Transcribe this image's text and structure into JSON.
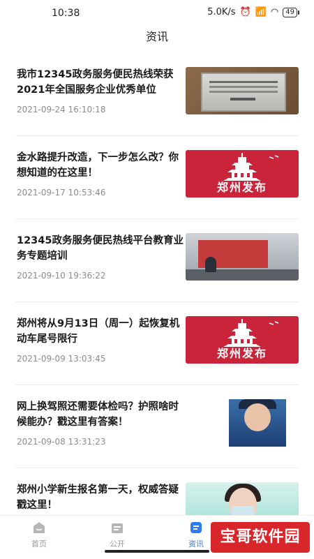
{
  "status_bar": {
    "time": "10:38",
    "network_speed": "5.0K/s",
    "battery": "49"
  },
  "header": {
    "title": "资讯"
  },
  "news": [
    {
      "title": "我市12345政务服务便民热线荣获2021年全国服务企业优秀单位",
      "date": "2021-09-24 16:10:18",
      "thumb_caption": ""
    },
    {
      "title": "金水路提升改造，下一步怎么改？你想知道的在这里！",
      "date": "2021-09-17 10:53:46",
      "thumb_caption": "郑州发布"
    },
    {
      "title": "12345政务服务便民热线平台教育业务专题培训",
      "date": "2021-09-10 19:36:22",
      "thumb_caption": ""
    },
    {
      "title": "郑州将从9月13日（周一）起恢复机动车尾号限行",
      "date": "2021-09-09 13:03:45",
      "thumb_caption": "郑州发布"
    },
    {
      "title": "网上换驾照还需要体检吗？护照啥时候能办？戳这里有答案！",
      "date": "2021-09-08 13:31:23",
      "thumb_caption": ""
    },
    {
      "title": "郑州小学新生报名第一天，权威答疑戳这里！",
      "date": "",
      "thumb_caption": ""
    }
  ],
  "bottom_nav": [
    {
      "label": "首页",
      "icon": "home-icon"
    },
    {
      "label": "公开",
      "icon": "folder-icon"
    },
    {
      "label": "资讯",
      "icon": "news-icon"
    }
  ],
  "watermark": "宝哥软件园",
  "colors": {
    "accent": "#2f7bf6",
    "brand_red": "#c9243a"
  }
}
